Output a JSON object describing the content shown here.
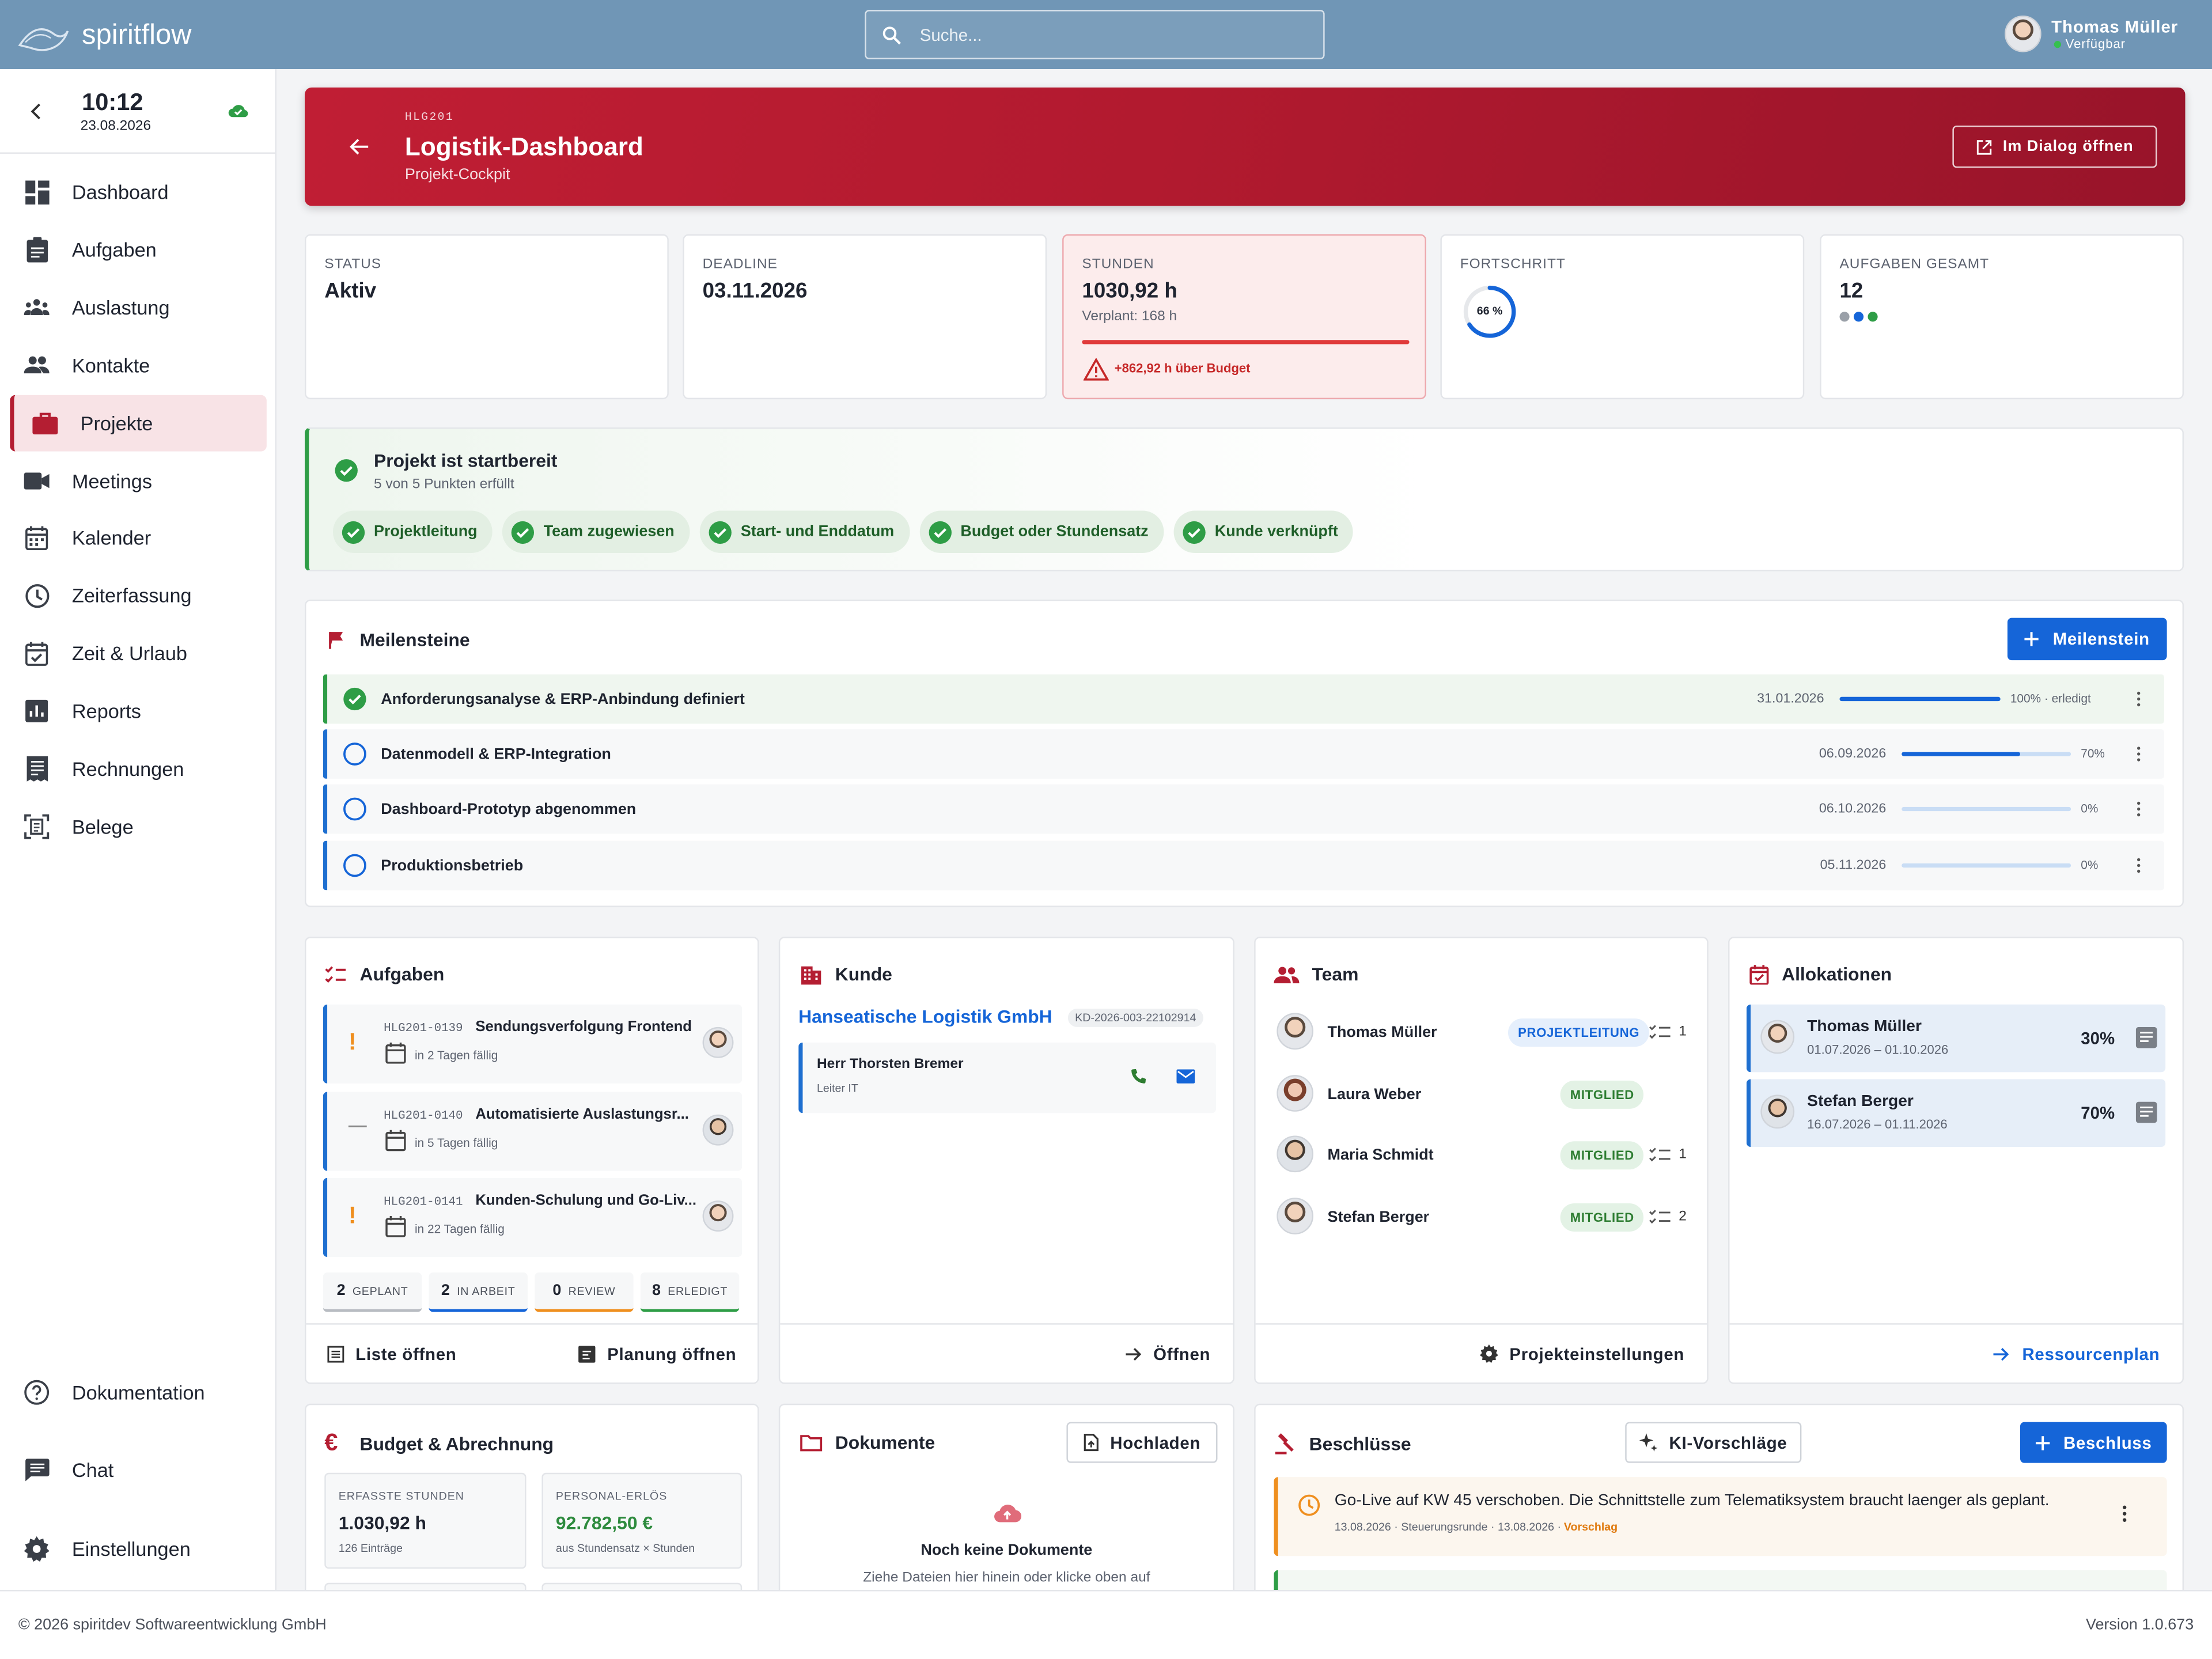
{
  "app": {
    "name": "spiritflow"
  },
  "search": {
    "placeholder": "Suche..."
  },
  "user": {
    "name": "Thomas Müller",
    "status": "Verfügbar"
  },
  "clock": {
    "time": "10:12",
    "date": "23.08.2026"
  },
  "nav": {
    "items": [
      "Dashboard",
      "Aufgaben",
      "Auslastung",
      "Kontakte",
      "Projekte",
      "Meetings",
      "Kalender",
      "Zeiterfassung",
      "Zeit & Urlaub",
      "Reports",
      "Rechnungen",
      "Belege"
    ],
    "bottom": [
      "Dokumentation",
      "Chat",
      "Einstellungen"
    ]
  },
  "header": {
    "code": "HLG201",
    "title": "Logistik-Dashboard",
    "subtitle": "Projekt-Cockpit",
    "dialog_button": "Im Dialog öffnen"
  },
  "kpis": {
    "status": {
      "label": "STATUS",
      "value": "Aktiv"
    },
    "deadline": {
      "label": "DEADLINE",
      "value": "03.11.2026"
    },
    "hours": {
      "label": "STUNDEN",
      "value": "1030,92 h",
      "planned": "Verplant: 168 h",
      "over": "+862,92 h über Budget"
    },
    "progress": {
      "label": "FORTSCHRITT",
      "value": "66 %",
      "fraction": 0.66
    },
    "tasks": {
      "label": "AUFGABEN GESAMT",
      "value": "12"
    }
  },
  "readiness": {
    "title": "Projekt ist startbereit",
    "subtitle": "5 von 5 Punkten erfüllt",
    "chips": [
      "Projektleitung",
      "Team zugewiesen",
      "Start- und Enddatum",
      "Budget oder Stundensatz",
      "Kunde verknüpft"
    ]
  },
  "milestones": {
    "title": "Meilensteine",
    "add_button": "Meilenstein",
    "items": [
      {
        "name": "Anforderungsanalyse & ERP-Anbindung definiert",
        "date": "31.01.2026",
        "pct": "100% · erledigt",
        "progress": 1.0,
        "done": true
      },
      {
        "name": "Datenmodell & ERP-Integration",
        "date": "06.09.2026",
        "pct": "70%",
        "progress": 0.7,
        "done": false
      },
      {
        "name": "Dashboard-Prototyp abgenommen",
        "date": "06.10.2026",
        "pct": "0%",
        "progress": 0.0,
        "done": false
      },
      {
        "name": "Produktionsbetrieb",
        "date": "05.11.2026",
        "pct": "0%",
        "progress": 0.0,
        "done": false
      }
    ]
  },
  "tasks": {
    "title": "Aufgaben",
    "items": [
      {
        "id": "HLG201-0139",
        "name": "Sendungsverfolgung Frontend",
        "due": "in 2 Tagen fällig",
        "prio": "!"
      },
      {
        "id": "HLG201-0140",
        "name": "Automatisierte Auslastungsr...",
        "due": "in 5 Tagen fällig",
        "prio": "—"
      },
      {
        "id": "HLG201-0141",
        "name": "Kunden-Schulung und Go-Liv...",
        "due": "in 22 Tagen fällig",
        "prio": "!"
      }
    ],
    "stats": [
      {
        "n": "2",
        "label": "GEPLANT"
      },
      {
        "n": "2",
        "label": "IN ARBEIT"
      },
      {
        "n": "0",
        "label": "REVIEW"
      },
      {
        "n": "8",
        "label": "ERLEDIGT"
      }
    ],
    "list_button": "Liste öffnen",
    "plan_button": "Planung öffnen"
  },
  "customer": {
    "title": "Kunde",
    "name": "Hanseatische Logistik GmbH",
    "id": "KD-2026-003-22102914",
    "contact": {
      "name": "Herr Thorsten Bremer",
      "role": "Leiter IT"
    },
    "open_button": "Öffnen"
  },
  "team": {
    "title": "Team",
    "settings_button": "Projekteinstellungen",
    "members": [
      {
        "name": "Thomas Müller",
        "role": "PROJEKTLEITUNG",
        "tasks": "1"
      },
      {
        "name": "Laura Weber",
        "role": "MITGLIED",
        "tasks": ""
      },
      {
        "name": "Maria Schmidt",
        "role": "MITGLIED",
        "tasks": "1"
      },
      {
        "name": "Stefan Berger",
        "role": "MITGLIED",
        "tasks": "2"
      }
    ]
  },
  "allocations": {
    "title": "Allokationen",
    "plan_button": "Ressourcenplan",
    "items": [
      {
        "name": "Thomas Müller",
        "range": "01.07.2026 – 01.10.2026",
        "pct": "30%"
      },
      {
        "name": "Stefan Berger",
        "range": "16.07.2026 – 01.11.2026",
        "pct": "70%"
      }
    ]
  },
  "budget": {
    "title": "Budget & Abrechnung",
    "hours": {
      "label": "ERFASSTE STUNDEN",
      "value": "1.030,92 h",
      "sub": "126 Einträge"
    },
    "revenue": {
      "label": "PERSONAL-ERLÖS",
      "value": "92.782,50 €",
      "sub": "aus Stundensatz × Stunden"
    }
  },
  "documents": {
    "title": "Dokumente",
    "upload_button": "Hochladen",
    "empty_title": "Noch keine Dokumente",
    "empty_text": "Ziehe Dateien hier hinein oder klicke oben auf"
  },
  "decisions": {
    "title": "Beschlüsse",
    "ai_button": "KI-Vorschläge",
    "add_button": "Beschluss",
    "items": [
      {
        "text": "Go-Live auf KW 45 verschoben. Die Schnittstelle zum Telematiksystem braucht laenger als geplant.",
        "meta": "13.08.2026 · Steuerungsrunde · 13.08.2026 · ",
        "tag": "Vorschlag"
      }
    ]
  },
  "footer": {
    "copyright": "© 2026 spiritdev Softwareentwicklung GmbH",
    "version": "Version 1.0.673"
  },
  "colors": {
    "topbar": "#7096b6",
    "brand_red": "#b41e32",
    "blue": "#1565d8",
    "green": "#2e9d46"
  }
}
